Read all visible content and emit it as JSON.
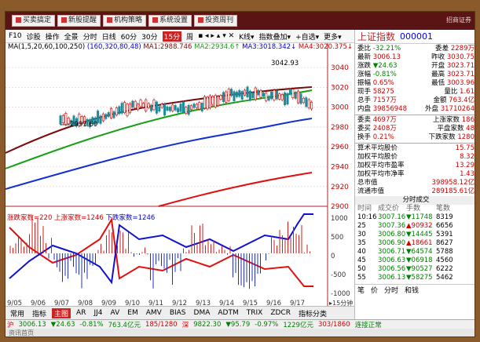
{
  "menu": [
    {
      "label": "买卖搞定"
    },
    {
      "label": "新股提醒"
    },
    {
      "label": "机构策略"
    },
    {
      "label": "系统设置"
    },
    {
      "label": "投资周刊"
    }
  ],
  "brand": "招商证券",
  "toolbar": {
    "items": [
      "F10",
      "诊股",
      "操作",
      "全景"
    ],
    "periods": [
      "分时",
      "日线",
      "60分",
      "30分",
      "15分",
      "周"
    ],
    "active_period": "15分",
    "right_items": [
      "K线▾",
      "指数叠加▾",
      "+自选▾",
      "更多▾"
    ]
  },
  "ma_line": {
    "prefix": "MA(1,5,20,60,100,250)",
    "params": "(160,320,80,48)",
    "ma1": "MA1:2988.746",
    "ma2": "MA2:2934.6↑",
    "ma3": "MA3:3018.342↓",
    "ma4": "MA4:3020.375↓"
  },
  "price_axis": [
    "3040",
    "3020",
    "3000",
    "2980",
    "2960",
    "2940",
    "2920",
    "2900"
  ],
  "annotations": {
    "high": "3042.93",
    "low": "2991.60"
  },
  "sub_indicator": {
    "label1": "涨跌家数=220",
    "label2": "上涨家数=1246",
    "label3": "下跌家数=1246",
    "axis": [
      "1000",
      "500",
      "0",
      "-500",
      "-1000"
    ]
  },
  "x_axis": [
    "9/05",
    "9/06",
    "9/07",
    "9/08",
    "9/09",
    "9/10",
    "9/11",
    "9/12",
    "9/13",
    "9/14",
    "9/15",
    "9/16",
    "9/17"
  ],
  "x_axis_suffix": "▸15分钟",
  "bottom_tabs": [
    "常用",
    "指标",
    "主图",
    "AR",
    "JJ4",
    "AV",
    "EM",
    "AMV",
    "BIAS",
    "DMA",
    "ADTM",
    "TRIX",
    "ZDCR",
    "指标分类"
  ],
  "active_bottom_tab": "主图",
  "right_panel": {
    "title": "上证指数",
    "code": "000001",
    "header_row": {
      "l1": "委比",
      "v1": "-32.21%",
      "l2": "委差",
      "v2": "2289万"
    },
    "quote_rows": [
      {
        "l1": "最新",
        "v1": "3006.13",
        "l2": "昨收",
        "v2": "3030.75"
      },
      {
        "l1": "涨跌",
        "v1": "▼24.63",
        "l2": "开盘",
        "v2": "3023.71"
      },
      {
        "l1": "涨幅",
        "v1": "-0.81%",
        "l2": "最高",
        "v2": "3023.71"
      },
      {
        "l1": "振幅",
        "v1": "0.65%",
        "l2": "最低",
        "v2": "3003.96"
      },
      {
        "l1": "现手",
        "v1": "58275",
        "l2": "量比",
        "v2": "1.61"
      },
      {
        "l1": "总手",
        "v1": "7157万",
        "l2": "金额",
        "v2": "763.4亿"
      },
      {
        "l1": "内盘",
        "v1": "39856948",
        "l2": "外盘",
        "v2": "31710264"
      }
    ],
    "breadth_rows": [
      {
        "l1": "委卖",
        "v1": "4697万",
        "l2": "上涨家数",
        "v2": "186"
      },
      {
        "l1": "委买",
        "v1": "2408万",
        "l2": "平盘家数",
        "v2": "48"
      },
      {
        "l1": "换手",
        "v1": "0.21%",
        "l2": "下跌家数",
        "v2": "1280"
      }
    ],
    "stats": [
      {
        "label": "算术平均股价",
        "value": "15.75"
      },
      {
        "label": "加权平均股价",
        "value": "8.32"
      },
      {
        "label": "加权平均市盈率",
        "value": "13.29"
      },
      {
        "label": "加权平均市净率",
        "value": "1.43"
      },
      {
        "label": "总市值",
        "value": "398958.12亿"
      },
      {
        "label": "流通市值",
        "value": "289185.61亿"
      }
    ],
    "ticks_title": "分时成交",
    "ticks_headers": [
      "时间",
      "成交价",
      "手数",
      "笔数"
    ],
    "ticks": [
      {
        "t": "10:16",
        "p": "3007.16",
        "v": "▼11748",
        "n": "8319"
      },
      {
        "t": "25",
        "p": "3007.36",
        "v": "▲90932",
        "n": "6656"
      },
      {
        "t": "30",
        "p": "3006.80",
        "v": "▼14445",
        "n": "5391"
      },
      {
        "t": "35",
        "p": "3006.90",
        "v": "▲18661",
        "n": "8627"
      },
      {
        "t": "40",
        "p": "3006.71",
        "v": "▼64574",
        "n": "5788"
      },
      {
        "t": "45",
        "p": "3006.63",
        "v": "▼06918",
        "n": "4560"
      },
      {
        "t": "50",
        "p": "3006.56",
        "v": "▼90527",
        "n": "6222"
      },
      {
        "t": "55",
        "p": "3006.13",
        "v": "▼58275",
        "n": "5462"
      }
    ],
    "tabs": [
      "笔",
      "价",
      "分时",
      "和钱"
    ]
  },
  "statusbar": {
    "sh": "沪",
    "sh_price": "3006.13",
    "sh_chg": "▼24.63",
    "sh_pct": "-0.81%",
    "sh_amt": "763.4亿元",
    "sh_updown": "185/1280",
    "sz": "深",
    "sz_price": "9822.30",
    "sz_chg": "▼95.79",
    "sz_pct": "-0.97%",
    "sz_amt": "1229亿元",
    "sz_updown": "303/1860",
    "conn": "连接正常"
  },
  "bottom_strip": "资讯首页",
  "colors": {
    "up": "#d00000",
    "down": "#008000",
    "ma_dark_red": "#7a0b0b",
    "ma_green": "#18a018",
    "ma_blue": "#1030d0",
    "ma_red": "#e01010"
  }
}
